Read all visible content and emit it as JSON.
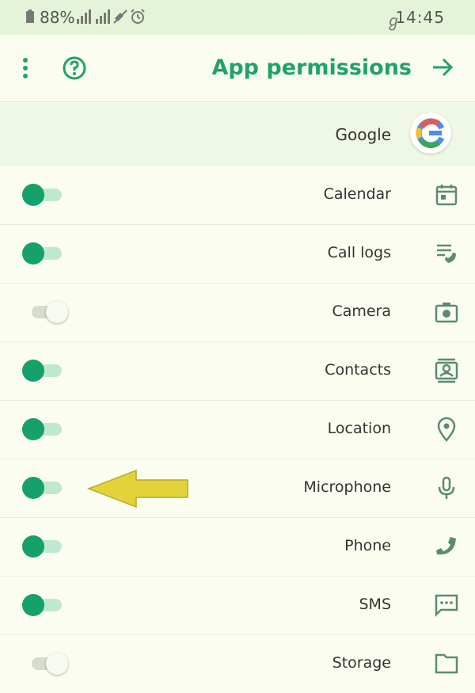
{
  "status_bar": {
    "time": "14:45",
    "key_glyph": "ℊ",
    "battery_percent": "88%",
    "icons": [
      "battery-icon",
      "signal-icon",
      "signal-icon",
      "mute-icon",
      "alarm-icon"
    ]
  },
  "app_bar": {
    "title": "App permissions",
    "back_icon": "arrow-icon",
    "help_icon": "help-icon",
    "more_icon": "more-vert-icon"
  },
  "app": {
    "name": "Google",
    "logo_icon": "google-logo-icon"
  },
  "permissions": [
    {
      "label": "Calendar",
      "icon": "calendar-icon",
      "enabled": true
    },
    {
      "label": "Call logs",
      "icon": "call-log-icon",
      "enabled": true
    },
    {
      "label": "Camera",
      "icon": "camera-icon",
      "enabled": false
    },
    {
      "label": "Contacts",
      "icon": "contacts-icon",
      "enabled": true
    },
    {
      "label": "Location",
      "icon": "location-icon",
      "enabled": true
    },
    {
      "label": "Microphone",
      "icon": "microphone-icon",
      "enabled": true
    },
    {
      "label": "Phone",
      "icon": "phone-icon",
      "enabled": true
    },
    {
      "label": "SMS",
      "icon": "sms-icon",
      "enabled": true
    },
    {
      "label": "Storage",
      "icon": "storage-icon",
      "enabled": false
    }
  ],
  "annotation": {
    "icon": "yellow-arrow-icon",
    "color": "#e3d33a",
    "points_to": "Microphone"
  },
  "colors": {
    "accent": "#1fa36a",
    "toggle_on": "#16a06b",
    "status_bar_bg": "#e5f4d8",
    "page_bg": "#fbfdf1"
  }
}
